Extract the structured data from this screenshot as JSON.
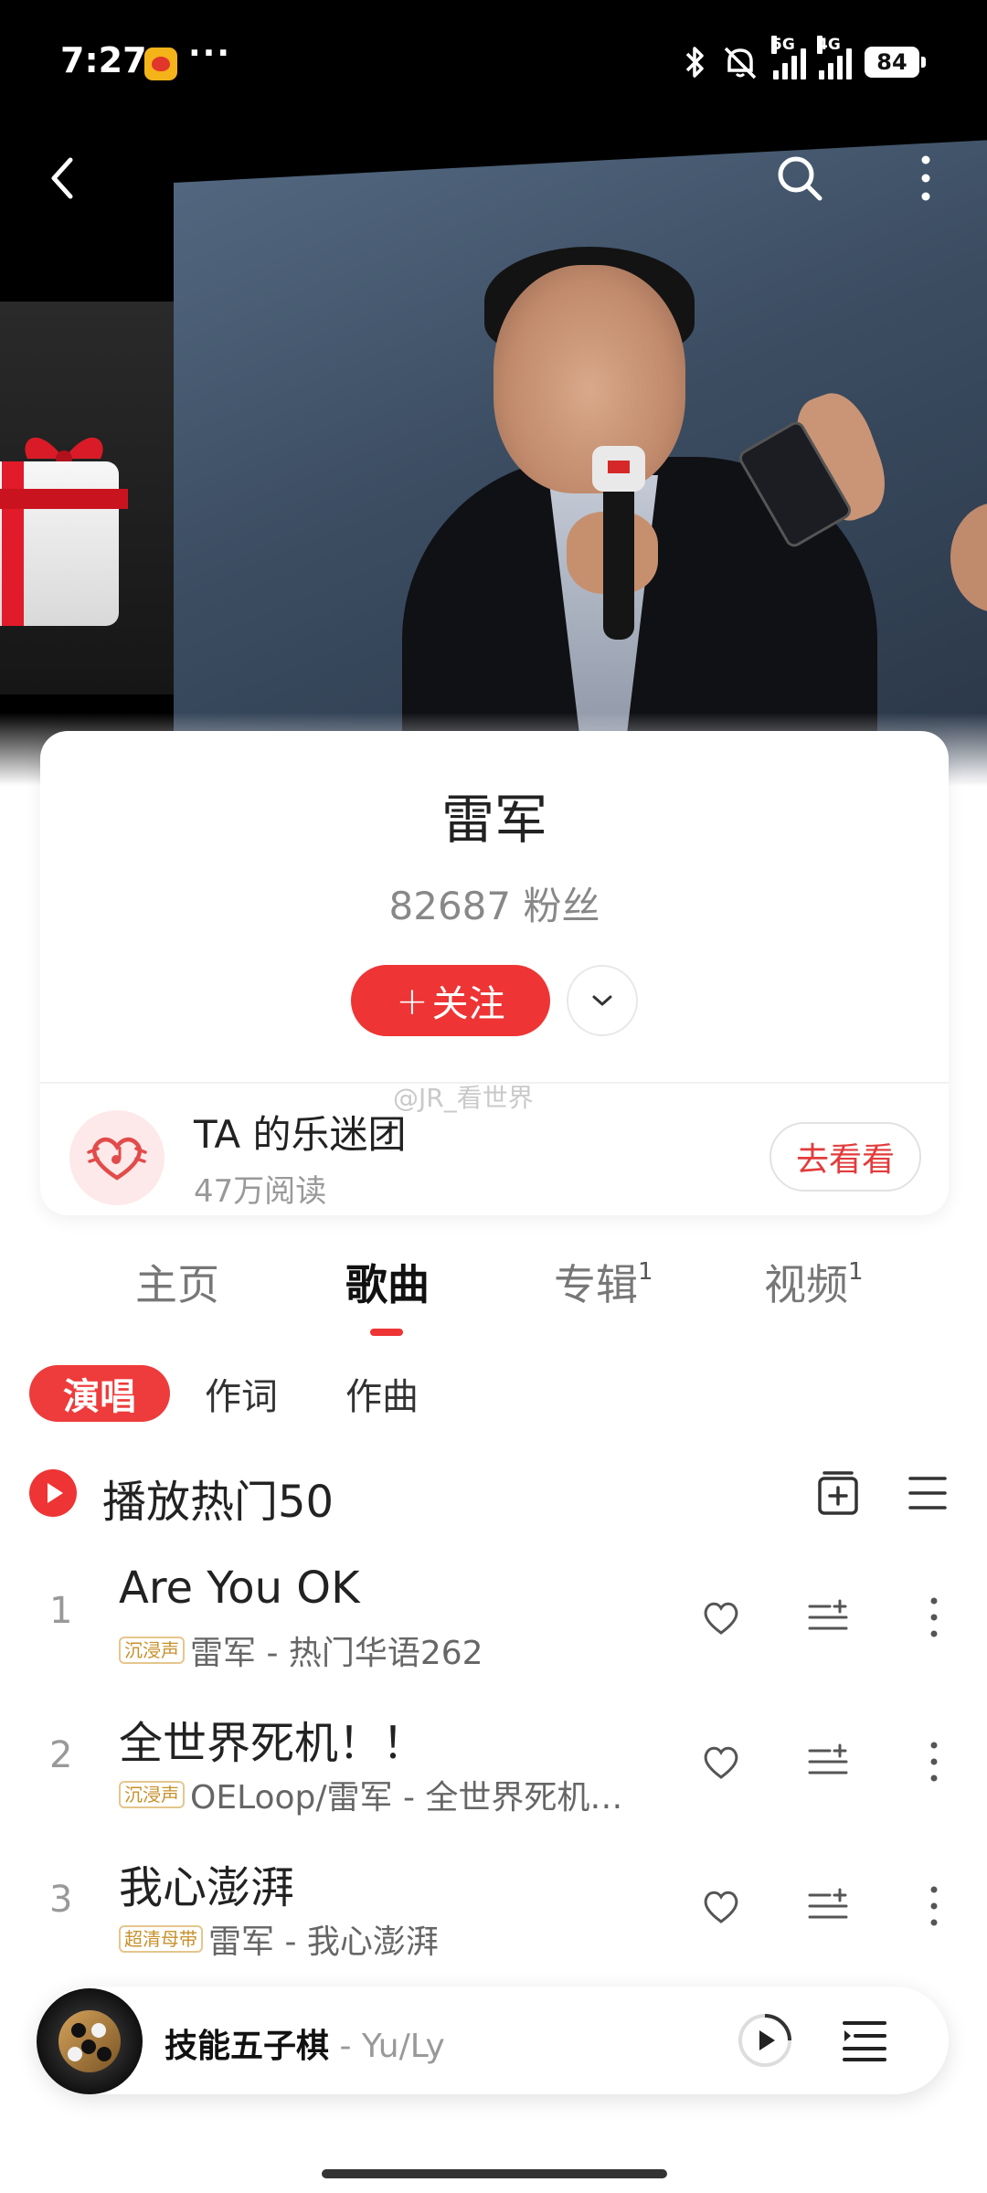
{
  "status_bar": {
    "time": "7:27",
    "more": "···",
    "network_1": "5G",
    "network_2": "4G",
    "battery": "84"
  },
  "nav": {
    "back_icon": "chevron-left-icon",
    "search_icon": "search-icon",
    "more_icon": "more-vertical-icon"
  },
  "artist": {
    "name": "雷军",
    "fans": "82687 粉丝",
    "follow_plus": "+",
    "follow_label": "关注"
  },
  "fan_club": {
    "title": "TA 的乐迷团",
    "reads": "47万阅读",
    "button": "去看看"
  },
  "watermark": "@JR_看世界",
  "tabs": [
    {
      "label": "主页",
      "sup": ""
    },
    {
      "label": "歌曲",
      "sup": ""
    },
    {
      "label": "专辑",
      "sup": "1"
    },
    {
      "label": "视频",
      "sup": "1"
    }
  ],
  "active_tab": "歌曲",
  "filters": [
    "演唱",
    "作词",
    "作曲"
  ],
  "active_filter": "演唱",
  "play_hot_label": "播放热门50",
  "songs": [
    {
      "index": "1",
      "title": "Are You OK",
      "badge": "沉浸声",
      "meta": "雷军 - 热门华语262"
    },
    {
      "index": "2",
      "title": "全世界死机！！",
      "badge": "沉浸声",
      "meta": "OELoop/雷军 - 全世界死机…"
    },
    {
      "index": "3",
      "title": "我心澎湃",
      "badge": "超清母带",
      "meta": "雷军 - 我心澎湃"
    }
  ],
  "mini_player": {
    "title": "技能五子棋",
    "separator": " - ",
    "artist": "Yu/Ly"
  },
  "colors": {
    "accent": "#ee3434",
    "badge_gold": "#c7902a"
  }
}
